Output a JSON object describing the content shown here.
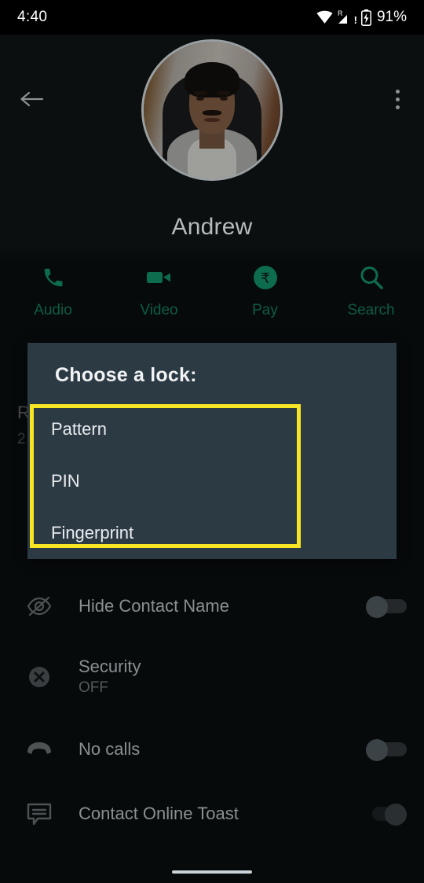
{
  "status_bar": {
    "time": "4:40",
    "battery_percent": "91%",
    "icons": [
      "wifi-icon",
      "roaming-signal-icon",
      "battery-charging-icon"
    ]
  },
  "header": {
    "back_icon": "arrow-left-icon",
    "overflow_icon": "more-vertical-icon",
    "avatar_alt": "contact-profile-photo",
    "contact_name": "Andrew"
  },
  "actions": [
    {
      "label": "Audio",
      "icon": "phone-icon"
    },
    {
      "label": "Video",
      "icon": "video-camera-icon"
    },
    {
      "label": "Pay",
      "icon": "rupee-circle-icon"
    },
    {
      "label": "Search",
      "icon": "search-icon"
    }
  ],
  "background_list": {
    "partial_title": "R",
    "partial_sub": "2"
  },
  "dialog": {
    "title": "Choose a lock:",
    "options": [
      "Pattern",
      "PIN",
      "Fingerprint"
    ],
    "highlight_color": "#f7e525",
    "background_color": "#2c3a44"
  },
  "settings": [
    {
      "title": "Hide Contact Name",
      "subtitle": "",
      "icon": "eye-off-icon",
      "toggle": "off"
    },
    {
      "title": "Security",
      "subtitle": "OFF",
      "icon": "x-circle-icon",
      "toggle": "none"
    },
    {
      "title": "No calls",
      "subtitle": "",
      "icon": "call-end-icon",
      "toggle": "off"
    },
    {
      "title": "Contact Online Toast",
      "subtitle": "",
      "icon": "message-icon",
      "toggle": "on"
    }
  ],
  "nav_bar": {
    "home_indicator": "gesture-home-bar"
  },
  "colors": {
    "accent_green": "#0d5c43",
    "screen_background": "#070a0b",
    "highlight_yellow": "#f7e525"
  }
}
